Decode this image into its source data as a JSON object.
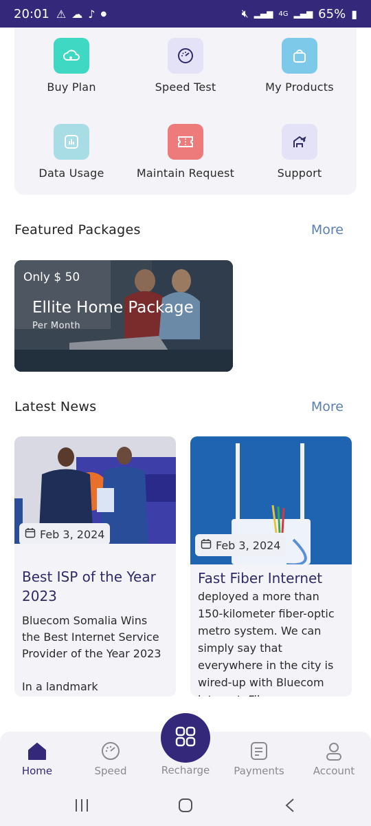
{
  "status_bar": {
    "time": "20:01",
    "network": "4G",
    "battery": "65%"
  },
  "quick_actions": [
    {
      "label": "Buy Plan",
      "icon": "cloud-plus-icon",
      "color": "#3fd8c2"
    },
    {
      "label": "Speed Test",
      "icon": "speedometer-icon",
      "color": "#e4e2f6"
    },
    {
      "label": "My Products",
      "icon": "shopping-bag-icon",
      "color": "#7cc9ea"
    },
    {
      "label": "Data Usage",
      "icon": "bar-chart-icon",
      "color": "#a9dde6"
    },
    {
      "label": "Maintain Request",
      "icon": "ticket-icon",
      "color": "#ee7b7b"
    },
    {
      "label": "Support",
      "icon": "support-house-icon",
      "color": "#e4e2f6"
    }
  ],
  "featured": {
    "title": "Featured Packages",
    "more": "More",
    "package": {
      "price": "Only $ 50",
      "name": "Ellite Home Package",
      "period": "Per Month"
    }
  },
  "news": {
    "title": "Latest News",
    "more": "More",
    "items": [
      {
        "date": "Feb 3, 2024",
        "title": "Best ISP of the Year 2023",
        "body": "Bluecom Somalia Wins the Best Internet Service Provider of the Year 2023\n\nIn a landmark"
      },
      {
        "date": "Feb 3, 2024",
        "title": "Fast Fiber Internet",
        "body": "deployed a more than 150-kilometer fiber-optic metro system. We can simply say that everywhere in the city is wired-up with Bluecom internet. Fiber"
      }
    ]
  },
  "bottom_nav": {
    "items": [
      {
        "label": "Home",
        "icon": "home-icon"
      },
      {
        "label": "Speed",
        "icon": "speedometer-icon"
      },
      {
        "label": "Recharge",
        "icon": "grid-icon"
      },
      {
        "label": "Payments",
        "icon": "receipt-icon"
      },
      {
        "label": "Account",
        "icon": "user-icon"
      }
    ],
    "active": "Home",
    "active_color": "#34287a"
  }
}
